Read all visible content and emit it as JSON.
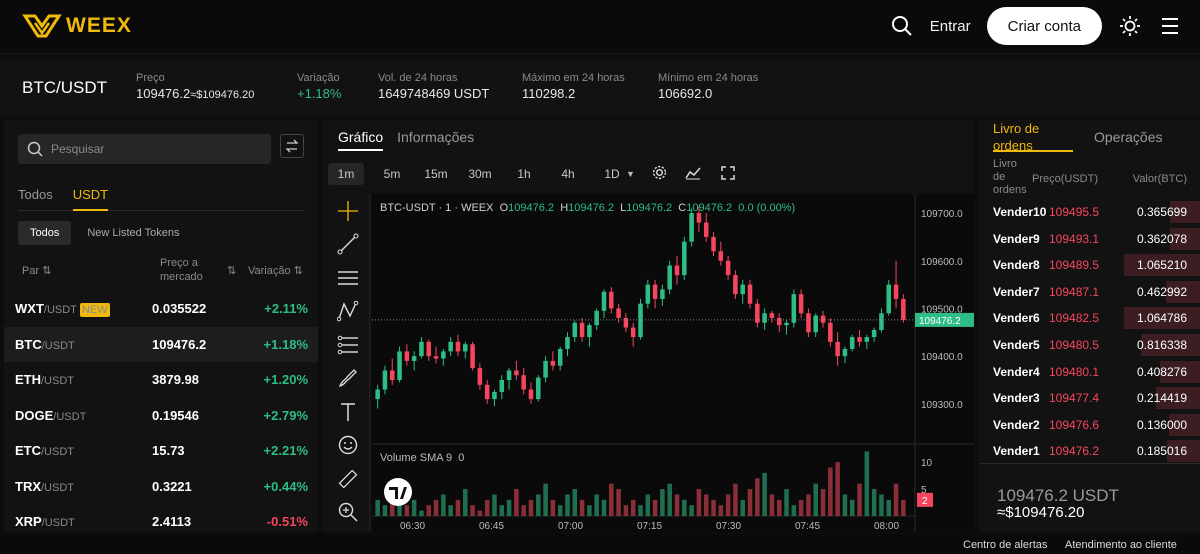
{
  "header": {
    "logo_text": "WEEX",
    "login_label": "Entrar",
    "signup_label": "Criar conta",
    "accent": "#f0b90b"
  },
  "ticker": {
    "pair": "BTC/USDT",
    "price_label": "Preço",
    "price": "109476.2",
    "price_usd": "≈$109476.20",
    "change_label": "Variação",
    "change": "+1.18%",
    "vol_label": "Vol. de 24 horas",
    "vol": "1649748469 USDT",
    "high_label": "Máximo em 24 horas",
    "high": "110298.2",
    "low_label": "Mínimo em 24 horas",
    "low": "106692.0"
  },
  "markets": {
    "search_placeholder": "Pesquisar",
    "tabs": [
      "Todos",
      "USDT"
    ],
    "subtabs": [
      "Todos",
      "New Listed Tokens"
    ],
    "col_pair": "Par",
    "col_price_1": "Preço a",
    "col_price_2": "mercado",
    "col_change": "Variação",
    "rows": [
      {
        "sym": "WXT",
        "quote": "/USDT",
        "badge": "NEW",
        "price": "0.035522",
        "change": "+2.11%"
      },
      {
        "sym": "BTC",
        "quote": "/USDT",
        "badge": "",
        "price": "109476.2",
        "change": "+1.18%"
      },
      {
        "sym": "ETH",
        "quote": "/USDT",
        "badge": "",
        "price": "3879.98",
        "change": "+1.20%"
      },
      {
        "sym": "DOGE",
        "quote": "/USDT",
        "badge": "",
        "price": "0.19546",
        "change": "+2.79%"
      },
      {
        "sym": "ETC",
        "quote": "/USDT",
        "badge": "",
        "price": "15.73",
        "change": "+2.21%"
      },
      {
        "sym": "TRX",
        "quote": "/USDT",
        "badge": "",
        "price": "0.3221",
        "change": "+0.44%"
      },
      {
        "sym": "XRP",
        "quote": "/USDT",
        "badge": "",
        "price": "2.4113",
        "change": "-0.51%"
      }
    ]
  },
  "chart": {
    "tabs": [
      "Gráfico",
      "Informações"
    ],
    "timeframes": [
      "1m",
      "5m",
      "15m",
      "30m",
      "1h",
      "4h",
      "1D"
    ],
    "legend_symbol": "BTC-USDT · 1 · WEEX",
    "o_label": "O",
    "o": "109476.2",
    "h_label": "H",
    "h": "109476.2",
    "l_label": "L",
    "l": "109476.2",
    "c_label": "C",
    "c": "109476.2",
    "chg": "0.0 (0.00%)",
    "volume_label": "Volume SMA 9",
    "volume_value": "0",
    "current_price_tag": "109476.2",
    "volume_tag": "2"
  },
  "chart_data": {
    "type": "candlestick",
    "y_ticks": [
      "109700.0",
      "109600.0",
      "109500.0",
      "109400.0",
      "109300.0"
    ],
    "y_tick_values": [
      109700,
      109600,
      109500,
      109400,
      109300
    ],
    "ylim": [
      109220,
      109740
    ],
    "x_ticks": [
      "06:30",
      "06:45",
      "07:00",
      "07:15",
      "07:30",
      "07:45",
      "08:00"
    ],
    "vol_ticks": [
      "10",
      "5"
    ],
    "vol_tick_values": [
      10,
      5
    ],
    "vol_lim": [
      0,
      13
    ],
    "candles": [
      [
        109310,
        109340,
        109290,
        109330
      ],
      [
        109330,
        109380,
        109320,
        109370
      ],
      [
        109370,
        109395,
        109340,
        109350
      ],
      [
        109350,
        109420,
        109345,
        109410
      ],
      [
        109410,
        109425,
        109380,
        109390
      ],
      [
        109390,
        109410,
        109370,
        109400
      ],
      [
        109400,
        109440,
        109395,
        109430
      ],
      [
        109430,
        109435,
        109390,
        109400
      ],
      [
        109400,
        109420,
        109385,
        109395
      ],
      [
        109395,
        109415,
        109380,
        109410
      ],
      [
        109410,
        109440,
        109400,
        109430
      ],
      [
        109430,
        109445,
        109400,
        109410
      ],
      [
        109410,
        109430,
        109395,
        109425
      ],
      [
        109425,
        109430,
        109370,
        109375
      ],
      [
        109375,
        109385,
        109330,
        109340
      ],
      [
        109340,
        109350,
        109300,
        109310
      ],
      [
        109310,
        109330,
        109295,
        109325
      ],
      [
        109325,
        109360,
        109310,
        109350
      ],
      [
        109350,
        109375,
        109330,
        109370
      ],
      [
        109370,
        109390,
        109350,
        109360
      ],
      [
        109360,
        109375,
        109320,
        109330
      ],
      [
        109330,
        109345,
        109300,
        109310
      ],
      [
        109310,
        109360,
        109305,
        109355
      ],
      [
        109355,
        109400,
        109345,
        109390
      ],
      [
        109390,
        109410,
        109370,
        109380
      ],
      [
        109380,
        109420,
        109370,
        109415
      ],
      [
        109415,
        109450,
        109400,
        109440
      ],
      [
        109440,
        109475,
        109430,
        109470
      ],
      [
        109470,
        109480,
        109430,
        109440
      ],
      [
        109440,
        109470,
        109420,
        109465
      ],
      [
        109465,
        109500,
        109455,
        109495
      ],
      [
        109495,
        109540,
        109480,
        109535
      ],
      [
        109535,
        109545,
        109490,
        109500
      ],
      [
        109500,
        109510,
        109470,
        109480
      ],
      [
        109480,
        109490,
        109450,
        109460
      ],
      [
        109460,
        109470,
        109420,
        109440
      ],
      [
        109440,
        109520,
        109435,
        109510
      ],
      [
        109510,
        109560,
        109500,
        109550
      ],
      [
        109550,
        109560,
        109500,
        109520
      ],
      [
        109520,
        109550,
        109505,
        109540
      ],
      [
        109540,
        109600,
        109530,
        109590
      ],
      [
        109590,
        109610,
        109550,
        109570
      ],
      [
        109570,
        109650,
        109560,
        109640
      ],
      [
        109640,
        109710,
        109630,
        109700
      ],
      [
        109700,
        109715,
        109660,
        109680
      ],
      [
        109680,
        109700,
        109640,
        109650
      ],
      [
        109650,
        109660,
        109610,
        109620
      ],
      [
        109620,
        109640,
        109590,
        109600
      ],
      [
        109600,
        109610,
        109560,
        109570
      ],
      [
        109570,
        109580,
        109520,
        109530
      ],
      [
        109530,
        109560,
        109510,
        109550
      ],
      [
        109550,
        109560,
        109500,
        109510
      ],
      [
        109510,
        109520,
        109460,
        109470
      ],
      [
        109470,
        109500,
        109455,
        109490
      ],
      [
        109490,
        109495,
        109470,
        109480
      ],
      [
        109480,
        109490,
        109450,
        109465
      ],
      [
        109465,
        109475,
        109445,
        109470
      ],
      [
        109470,
        109540,
        109460,
        109530
      ],
      [
        109530,
        109540,
        109480,
        109490
      ],
      [
        109490,
        109500,
        109440,
        109450
      ],
      [
        109450,
        109490,
        109440,
        109485
      ],
      [
        109485,
        109495,
        109460,
        109470
      ],
      [
        109470,
        109480,
        109420,
        109430
      ],
      [
        109430,
        109450,
        109380,
        109400
      ],
      [
        109400,
        109420,
        109385,
        109415
      ],
      [
        109415,
        109445,
        109410,
        109440
      ],
      [
        109440,
        109455,
        109420,
        109430
      ],
      [
        109430,
        109445,
        109415,
        109440
      ],
      [
        109440,
        109460,
        109430,
        109455
      ],
      [
        109455,
        109500,
        109450,
        109490
      ],
      [
        109490,
        109560,
        109485,
        109550
      ],
      [
        109550,
        109600,
        109500,
        109520
      ],
      [
        109520,
        109530,
        109470,
        109476
      ]
    ],
    "volumes": [
      3,
      2,
      4,
      5,
      2,
      3,
      1,
      2,
      3,
      4,
      2,
      3,
      5,
      2,
      1,
      3,
      4,
      2,
      3,
      5,
      2,
      3,
      4,
      6,
      3,
      2,
      4,
      5,
      3,
      2,
      4,
      3,
      6,
      5,
      2,
      3,
      2,
      4,
      3,
      5,
      6,
      4,
      3,
      2,
      5,
      4,
      3,
      2,
      4,
      6,
      3,
      5,
      7,
      8,
      4,
      3,
      5,
      2,
      3,
      4,
      6,
      5,
      9,
      10,
      4,
      3,
      6,
      12,
      5,
      4,
      3,
      6,
      3
    ]
  },
  "orderbook": {
    "tab_book_1": "Livro de",
    "tab_book_2": "ordens",
    "tab_trades": "Operações",
    "head_level_1": "Livro",
    "head_level_2": "de",
    "head_level_3": "ordens",
    "head_price": "Preço(USDT)",
    "head_value": "Valor(BTC)",
    "rows": [
      {
        "level": "Vender10",
        "price": "109495.5",
        "value": "0.365699",
        "depth": 0.4
      },
      {
        "level": "Vender9",
        "price": "109493.1",
        "value": "0.362078",
        "depth": 0.4
      },
      {
        "level": "Vender8",
        "price": "109489.5",
        "value": "1.065210",
        "depth": 1.0
      },
      {
        "level": "Vender7",
        "price": "109487.1",
        "value": "0.462992",
        "depth": 0.45
      },
      {
        "level": "Vender6",
        "price": "109482.5",
        "value": "1.064786",
        "depth": 1.0
      },
      {
        "level": "Vender5",
        "price": "109480.5",
        "value": "0.816338",
        "depth": 0.78
      },
      {
        "level": "Vender4",
        "price": "109480.1",
        "value": "0.408276",
        "depth": 0.52
      },
      {
        "level": "Vender3",
        "price": "109477.4",
        "value": "0.214419",
        "depth": 0.58
      },
      {
        "level": "Vender2",
        "price": "109476.6",
        "value": "0.136000",
        "depth": 0.41
      },
      {
        "level": "Vender1",
        "price": "109476.2",
        "value": "0.185016",
        "depth": 0.44
      }
    ],
    "last_price": "109476.2 USDT",
    "last_usd": "≈$109476.20"
  },
  "footer": {
    "alerts": "Centro de alertas",
    "support": "Atendimento ao cliente"
  }
}
